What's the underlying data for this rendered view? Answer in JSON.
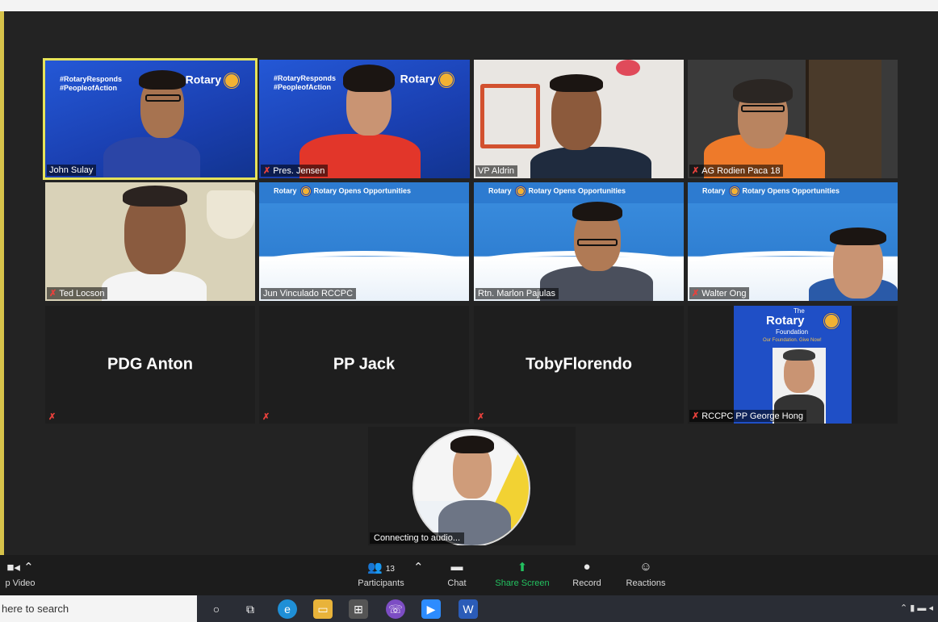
{
  "participants_tiles": [
    {
      "name": "John Sulay",
      "muted": false,
      "active_speaker": true
    },
    {
      "name": "Pres. Jensen",
      "muted": true
    },
    {
      "name": "VP Aldrin",
      "muted": false
    },
    {
      "name": "AG Rodien Paca 18",
      "muted": true
    },
    {
      "name": "Ted Locson",
      "muted": true
    },
    {
      "name": "Jun Vinculado RCCPC",
      "muted": false
    },
    {
      "name": "Rtn. Marlon Pajulas",
      "muted": false
    },
    {
      "name": "Walter Ong",
      "muted": true
    },
    {
      "name": "PDG Anton",
      "muted": true
    },
    {
      "name": "PP Jack",
      "muted": true
    },
    {
      "name": "TobyFlorendo",
      "muted": true
    },
    {
      "name": "RCCPC PP George Hong",
      "muted": true
    }
  ],
  "banner": {
    "hashtag1": "#RotaryResponds",
    "hashtag2": "#PeopleofAction",
    "rotary": "Rotary",
    "opens": "Rotary Opens Opportunities",
    "foundation_the": "The",
    "foundation": "Foundation",
    "foundation_tag": "Our Foundation. Give Now!"
  },
  "self_view": {
    "status": "Connecting to audio..."
  },
  "toolbar": {
    "video_label": "p Video",
    "participants_label": "Participants",
    "participants_count": "13",
    "chat_label": "Chat",
    "share_label": "Share Screen",
    "record_label": "Record",
    "reactions_label": "Reactions"
  },
  "taskbar": {
    "search_placeholder": "here to search"
  },
  "colors": {
    "active_border": "#e6e35a",
    "share_green": "#23c160",
    "mute_red": "#e8413c"
  }
}
